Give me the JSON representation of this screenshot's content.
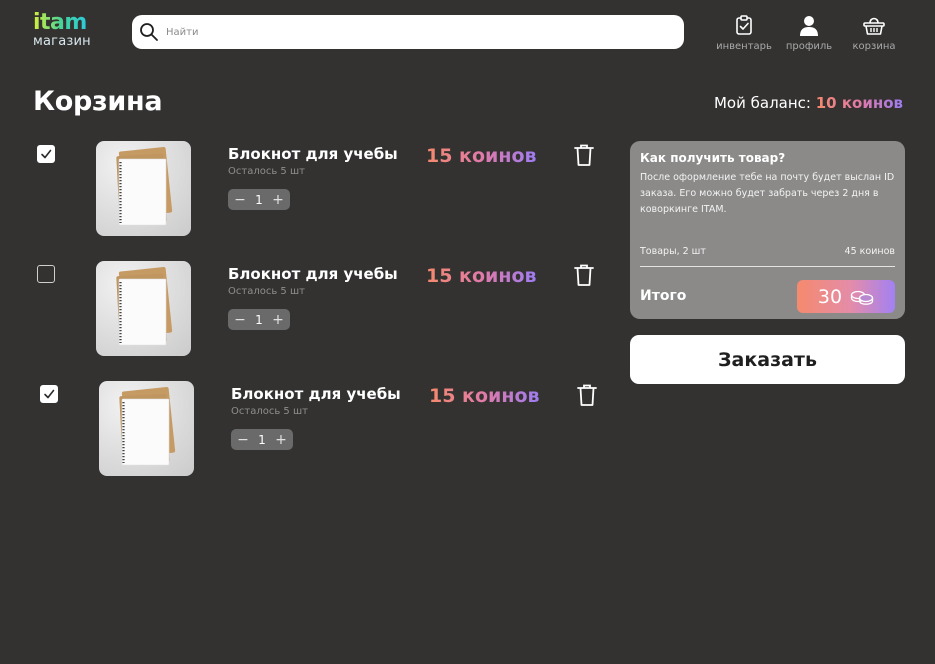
{
  "header": {
    "logo_main": "itam",
    "logo_sub": "магазин",
    "search_placeholder": "Найти",
    "nav": [
      {
        "label": "инвентарь",
        "icon": "clipboard-check-icon"
      },
      {
        "label": "профиль",
        "icon": "user-icon"
      },
      {
        "label": "корзина",
        "icon": "basket-icon"
      }
    ]
  },
  "page": {
    "title": "Корзина",
    "balance_label": "Мой баланс:",
    "balance_value": "10 коинов"
  },
  "cart": {
    "items": [
      {
        "title": "Блокнот для учебы",
        "stock": "Осталось 5 шт",
        "quantity": "1",
        "price": "15 коинов",
        "checked": true
      },
      {
        "title": "Блокнот для учебы",
        "stock": "Осталось 5 шт",
        "quantity": "1",
        "price": "15 коинов",
        "checked": false
      },
      {
        "title": "Блокнот для учебы",
        "stock": "Осталось 5 шт",
        "quantity": "1",
        "price": "15 коинов",
        "checked": true
      }
    ],
    "stepper_minus": "−",
    "stepper_plus": "+"
  },
  "summary": {
    "title": "Как получить товар?",
    "description": "После оформление тебе на почту будет выслан ID заказа. Его можно будет забрать через 2 дня в коворкинге ITAM.",
    "items_label": "Товары, 2 шт",
    "items_value": "45 коинов",
    "total_label": "Итого",
    "total_value": "30",
    "order_button": "Заказать"
  },
  "colors": {
    "background": "#333231",
    "card": "#8b8a89",
    "accent_start": "#f58a6d",
    "accent_end": "#9d7cf3"
  }
}
